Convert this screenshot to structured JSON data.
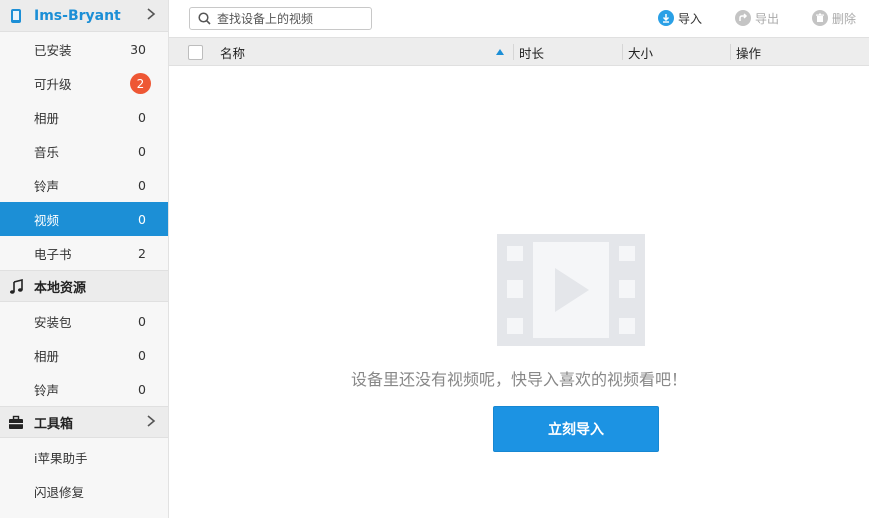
{
  "device": {
    "name": "Ims-Bryant",
    "items": [
      {
        "label": "已安装",
        "count": "30"
      },
      {
        "label": "可升级",
        "badge": "2"
      },
      {
        "label": "相册",
        "count": "0"
      },
      {
        "label": "音乐",
        "count": "0"
      },
      {
        "label": "铃声",
        "count": "0"
      },
      {
        "label": "视频",
        "count": "0"
      },
      {
        "label": "电子书",
        "count": "2"
      }
    ]
  },
  "local": {
    "title": "本地资源",
    "items": [
      {
        "label": "安装包",
        "count": "0"
      },
      {
        "label": "相册",
        "count": "0"
      },
      {
        "label": "铃声",
        "count": "0"
      }
    ]
  },
  "toolbox": {
    "title": "工具箱",
    "items": [
      {
        "label": "i苹果助手"
      },
      {
        "label": "闪退修复"
      }
    ]
  },
  "toolbar": {
    "search_placeholder": "查找设备上的视频",
    "import_label": "导入",
    "export_label": "导出",
    "delete_label": "删除"
  },
  "table": {
    "columns": [
      "名称",
      "时长",
      "大小",
      "操作"
    ]
  },
  "empty_state": {
    "message": "设备里还没有视频呢，快导入喜欢的视频看吧！",
    "button_label": "立刻导入"
  },
  "colors": {
    "accent": "#1c8fd6",
    "badge": "#ee5734",
    "button": "#1c93e3"
  }
}
